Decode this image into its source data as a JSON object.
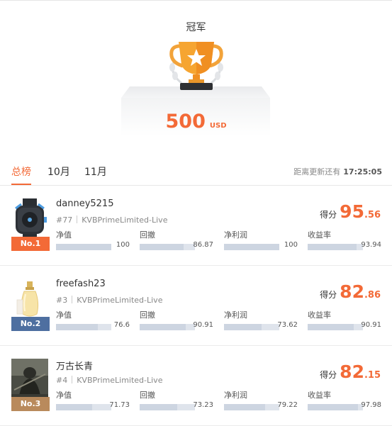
{
  "champion": {
    "title": "冠军",
    "prize_amount": "500",
    "prize_unit": "USD"
  },
  "tabs": [
    {
      "label": "总榜",
      "active": true
    },
    {
      "label": "10月",
      "active": false
    },
    {
      "label": "11月",
      "active": false
    }
  ],
  "update": {
    "label": "距离更新还有",
    "time": "17:25:05"
  },
  "colors": {
    "accent": "#f36a37",
    "badge_1": "#f36a37",
    "badge_2": "#4e6fa0",
    "badge_3": "#b98a5c",
    "bar": "#cdd5e1"
  },
  "score_label": "得分",
  "entries": [
    {
      "rank": "No.1",
      "name": "danney5215",
      "id": "#77",
      "account": "KVBPrimeLimited-Live",
      "score_int": "95",
      "score_dec": ".56",
      "image": "watch-image",
      "metrics": [
        {
          "label": "净值",
          "value": "100",
          "fraction": 1.0
        },
        {
          "label": "回撤",
          "value": "86.87",
          "fraction": 0.8
        },
        {
          "label": "净利润",
          "value": "100",
          "fraction": 1.0
        },
        {
          "label": "收益率",
          "value": "93.94",
          "fraction": 0.88
        }
      ]
    },
    {
      "rank": "No.2",
      "name": "freefash23",
      "id": "#3",
      "account": "KVBPrimeLimited-Live",
      "score_int": "82",
      "score_dec": ".86",
      "image": "perfume-bottle-image",
      "metrics": [
        {
          "label": "净值",
          "value": "76.6",
          "fraction": 0.75
        },
        {
          "label": "回撤",
          "value": "90.91",
          "fraction": 0.83
        },
        {
          "label": "净利润",
          "value": "73.62",
          "fraction": 0.68
        },
        {
          "label": "收益率",
          "value": "90.91",
          "fraction": 0.83
        }
      ]
    },
    {
      "rank": "No.3",
      "name": "万古长青",
      "id": "#4",
      "account": "KVBPrimeLimited-Live",
      "score_int": "82",
      "score_dec": ".15",
      "image": "warrior-image",
      "metrics": [
        {
          "label": "净值",
          "value": "71.73",
          "fraction": 0.66
        },
        {
          "label": "回撤",
          "value": "73.23",
          "fraction": 0.68
        },
        {
          "label": "净利润",
          "value": "79.22",
          "fraction": 0.74
        },
        {
          "label": "收益率",
          "value": "97.98",
          "fraction": 0.91
        }
      ]
    }
  ]
}
